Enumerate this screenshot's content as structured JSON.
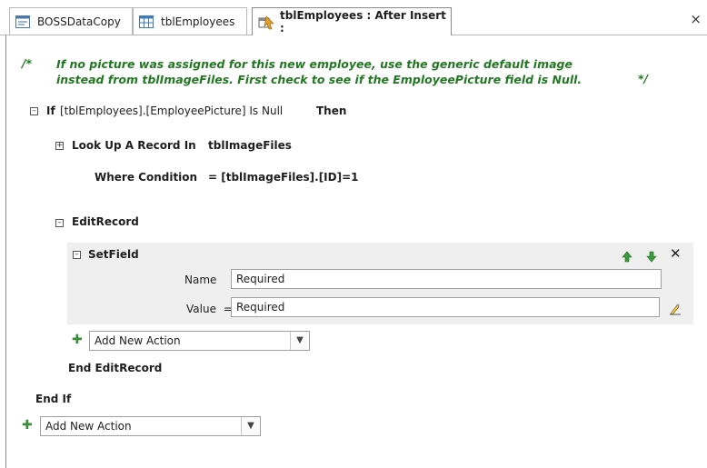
{
  "tabs": [
    {
      "label": "BOSSDataCopy"
    },
    {
      "label": "tblEmployees"
    },
    {
      "label": "tblEmployees : After Insert :"
    }
  ],
  "close_glyph": "×",
  "comment": {
    "open": "/*",
    "line1": "If no picture was assigned for this new employee, use the generic default image",
    "line2": "instead from tblImageFiles. First check to see if the EmployeePicture field is Null.",
    "close": "*/"
  },
  "if_block": {
    "keyword": "If",
    "condition": "[tblEmployees].[EmployeePicture] Is Null",
    "then": "Then",
    "end": "End If"
  },
  "lookup": {
    "label": "Look Up A Record In",
    "table": "tblImageFiles",
    "where_label": "Where Condition",
    "where_value": "= [tblImageFiles].[ID]=1"
  },
  "edit_record": {
    "label": "EditRecord",
    "end": "End EditRecord"
  },
  "setfield": {
    "label": "SetField",
    "name_label": "Name",
    "name_value": "Required",
    "value_label": "Value",
    "value_prefix": "=",
    "value_value": "Required"
  },
  "add_action": {
    "inner": "Add New Action",
    "outer": "Add New Action"
  },
  "icons": {
    "collapse": "⊟",
    "expand": "⊞",
    "add": "✚",
    "move_up": "arrow-up",
    "move_down": "arrow-down",
    "delete": "✕",
    "builder": "builder"
  }
}
